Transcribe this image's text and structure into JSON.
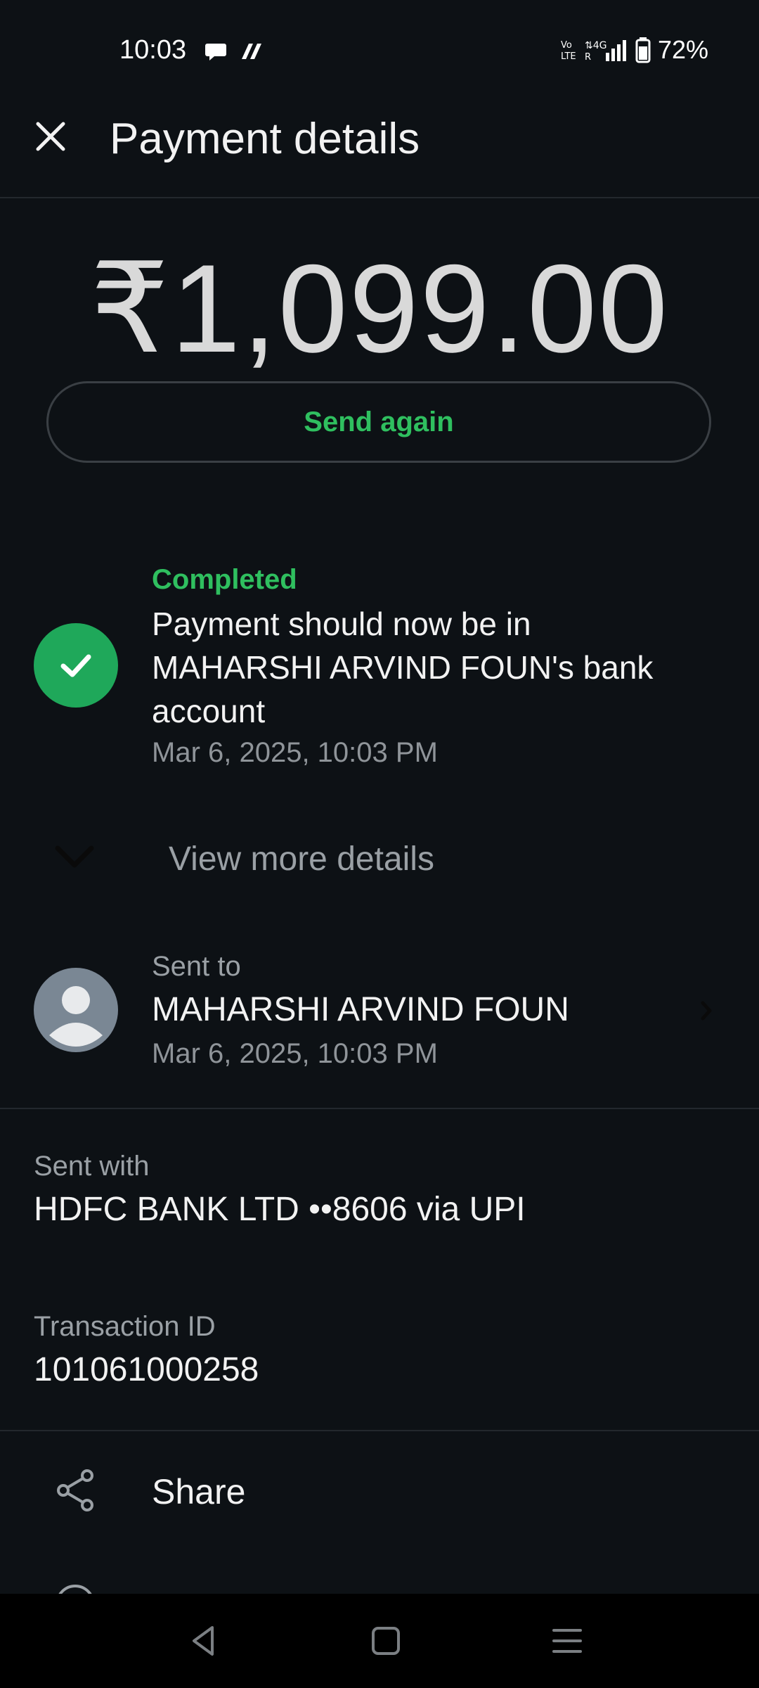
{
  "status_bar": {
    "time": "10:03",
    "battery": "72%",
    "notification_icons": [
      "chat-bubble-icon",
      "app-notification-icon"
    ],
    "system_icons": [
      "volte-icon",
      "4g-signal-icon",
      "battery-icon"
    ]
  },
  "header": {
    "title": "Payment details",
    "close_icon": "close-icon"
  },
  "amount": "₹1,099.00",
  "send_again_label": "Send again",
  "status": {
    "label": "Completed",
    "message": "Payment should now be in MAHARSHI ARVIND FOUN's bank account",
    "timestamp": "Mar 6, 2025, 10:03 PM"
  },
  "view_more_label": "View more details",
  "sent_to": {
    "label": "Sent to",
    "name": "MAHARSHI ARVIND FOUN",
    "timestamp": "Mar 6, 2025, 10:03 PM"
  },
  "sent_with": {
    "label": "Sent with",
    "value": "HDFC BANK LTD ••8606 via UPI"
  },
  "transaction": {
    "label": "Transaction ID",
    "value": "101061000258"
  },
  "actions": {
    "share_label": "Share"
  },
  "colors": {
    "background": "#0d1115",
    "accent_green": "#2fbf5f",
    "check_green": "#1fa85a"
  }
}
